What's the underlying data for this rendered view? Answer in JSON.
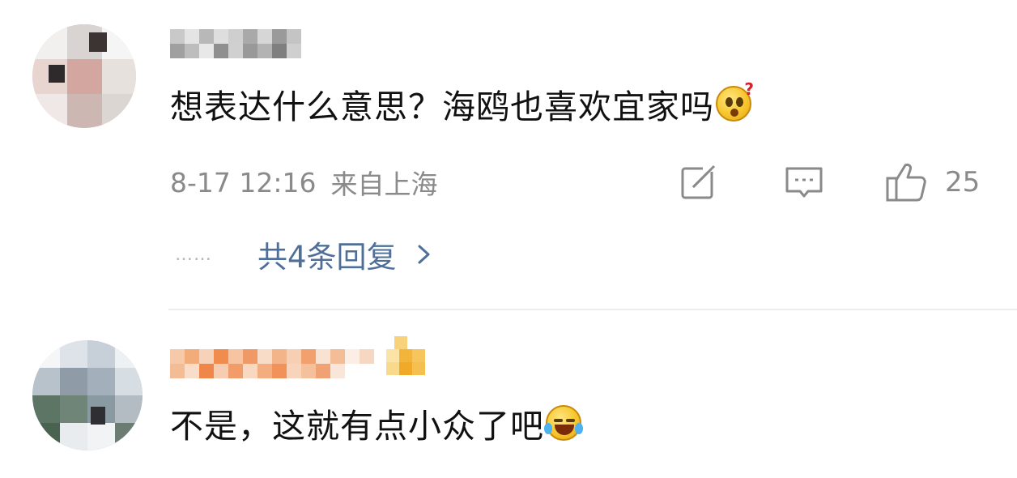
{
  "comments": [
    {
      "username_blurred": true,
      "text": "想表达什么意思？海鸥也喜欢宜家吗",
      "emoji": "thinking-face-emoji",
      "date": "8-17 12:16",
      "location": "来自上海",
      "likes": "25",
      "replies_label": "共4条回复",
      "replies_dots": "……"
    },
    {
      "username_blurred": true,
      "text": "不是，这就有点小众了吧",
      "emoji": "laughing-tears-emoji"
    }
  ],
  "icons": {
    "share": "share-icon",
    "comment": "comment-icon",
    "like": "thumbs-up-icon",
    "chevron": "chevron-right-icon"
  },
  "colors": {
    "text": "#111111",
    "meta": "#8a8a8a",
    "link": "#4f6f98",
    "divider": "#ececec"
  }
}
